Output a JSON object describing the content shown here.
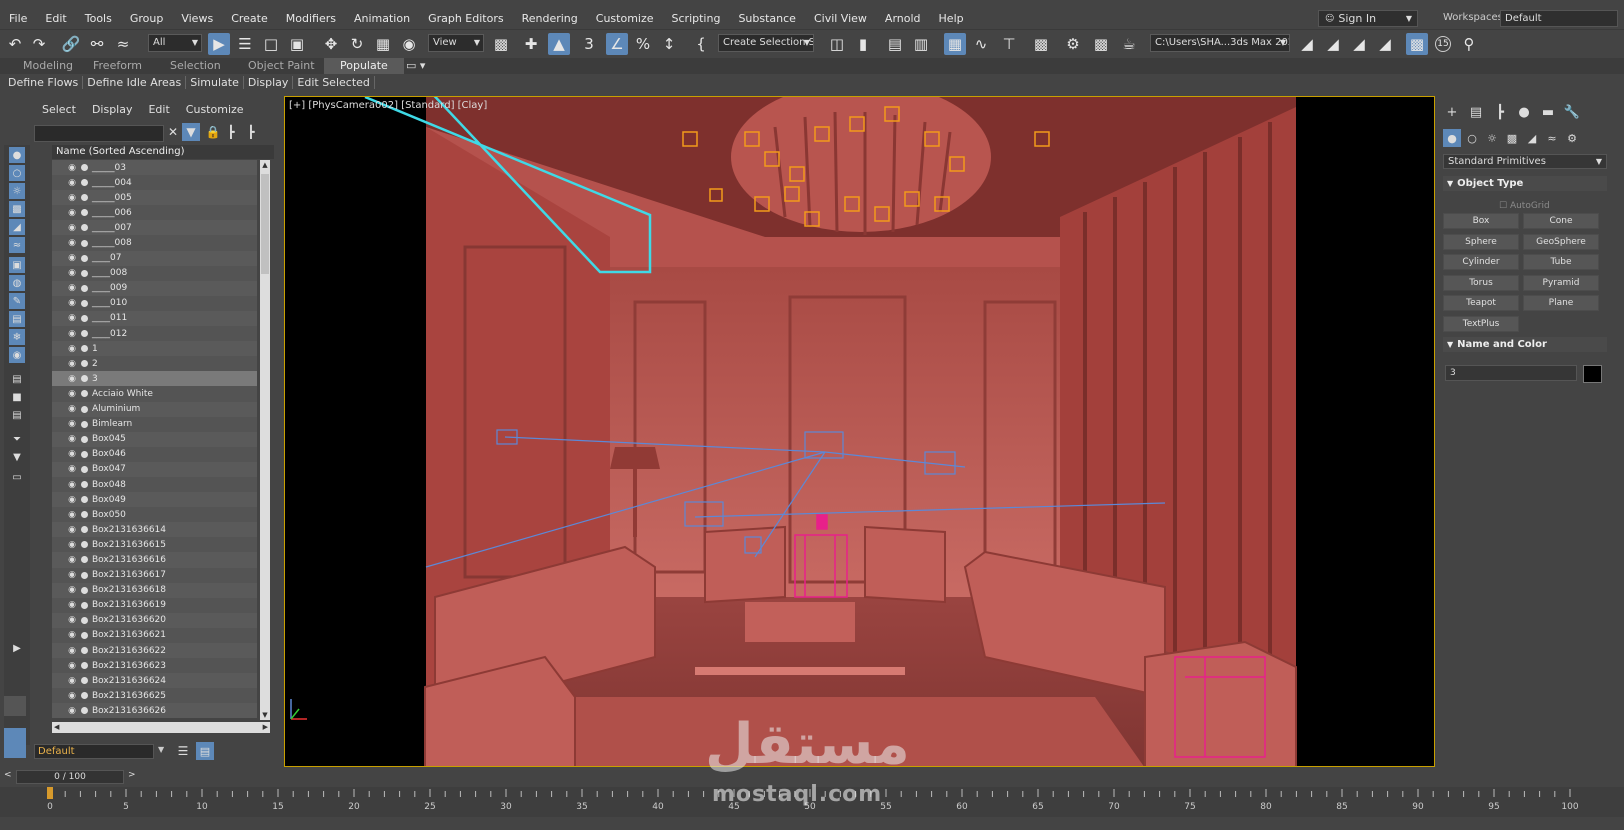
{
  "menu": [
    "File",
    "Edit",
    "Tools",
    "Group",
    "Views",
    "Create",
    "Modifiers",
    "Animation",
    "Graph Editors",
    "Rendering",
    "Customize",
    "Scripting",
    "Substance",
    "Civil View",
    "Arnold",
    "Help"
  ],
  "signin": {
    "label": "Sign In"
  },
  "workspace": {
    "label": "Workspaces:",
    "value": "Default"
  },
  "toolbar": {
    "filter_value": "All",
    "refcoord_value": "View",
    "selection_set_placeholder": "Create Selection Se",
    "path_value": "C:\\Users\\SHA...3ds Max 2024",
    "snap_angle": "3",
    "badge_15": "15"
  },
  "ribbon": {
    "tabs": [
      "Modeling",
      "Freeform",
      "Selection",
      "Object Paint",
      "Populate"
    ],
    "active_tab": "Populate",
    "subtabs": [
      "Define Flows",
      "Define Idle Areas",
      "Simulate",
      "Display",
      "Edit Selected"
    ]
  },
  "explorer": {
    "menu": [
      "Select",
      "Display",
      "Edit",
      "Customize"
    ],
    "column_header": "Name (Sorted Ascending)",
    "selected": "3",
    "items": [
      "_____03",
      "_____004",
      "_____005",
      "_____006",
      "_____007",
      "_____008",
      "____07",
      "____008",
      "____009",
      "____010",
      "____011",
      "____012",
      "1",
      "2",
      "3",
      "Acciaio White",
      "Aluminium",
      "Bimlearn",
      "Box045",
      "Box046",
      "Box047",
      "Box048",
      "Box049",
      "Box050",
      "Box2131636614",
      "Box2131636615",
      "Box2131636616",
      "Box2131636617",
      "Box2131636618",
      "Box2131636619",
      "Box2131636620",
      "Box2131636621",
      "Box2131636622",
      "Box2131636623",
      "Box2131636624",
      "Box2131636625",
      "Box2131636626"
    ]
  },
  "layer": {
    "value": "Default"
  },
  "viewport": {
    "label": "[+] [PhysCamera002] [Standard] [Clay]"
  },
  "command_panel": {
    "category": "Standard Primitives",
    "object_type_title": "Object Type",
    "autogrid_label": "AutoGrid",
    "buttons": [
      "Box",
      "Cone",
      "Sphere",
      "GeoSphere",
      "Cylinder",
      "Tube",
      "Torus",
      "Pyramid",
      "Teapot",
      "Plane",
      "TextPlus"
    ],
    "name_color_title": "Name and Color",
    "object_name": "3",
    "object_color": "#000000"
  },
  "time": {
    "frame_counter": "0 / 100",
    "ticks": [
      "0",
      "5",
      "10",
      "15",
      "20",
      "25",
      "30",
      "35",
      "40",
      "45",
      "50",
      "55",
      "60",
      "65",
      "70",
      "75",
      "80",
      "85",
      "90",
      "95",
      "100"
    ]
  },
  "watermark": {
    "arabic": "مستقل",
    "latin": "mostaql.com"
  },
  "colors": {
    "accent": "#5d88b8",
    "viewport_border": "#c8a000",
    "scene_tint": "#b5524d",
    "camera_line": "#3fd9e6",
    "light_helper": "#f29a1b",
    "selected_object": "#e8208a"
  }
}
